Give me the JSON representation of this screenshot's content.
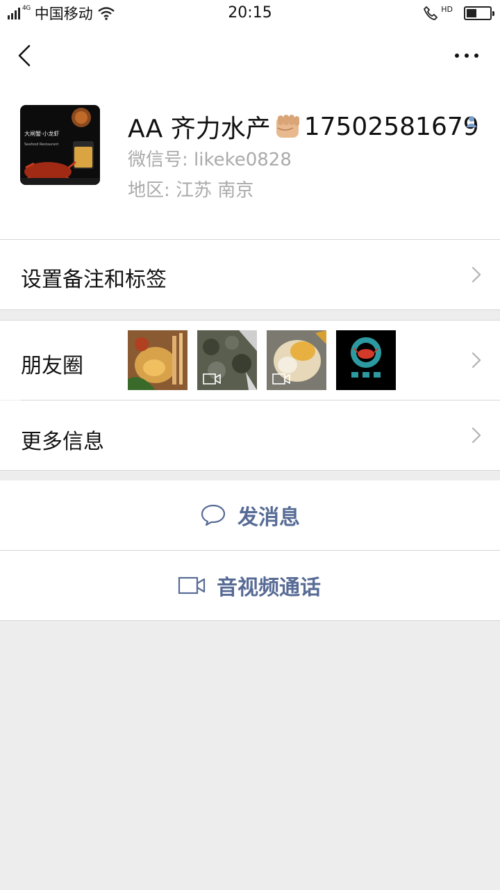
{
  "status_bar": {
    "network": "4G",
    "carrier": "中国移动",
    "time": "20:15",
    "hd": "HD",
    "battery_level": 0.45
  },
  "profile": {
    "name_prefix": "AA 齐力水产",
    "name_suffix": "17502581679",
    "wechat_id": "微信号: likeke0828",
    "region": "地区:  江苏  南京"
  },
  "cells": {
    "remark": "设置备注和标签",
    "moments": "朋友圈",
    "more_info": "更多信息"
  },
  "actions": {
    "message": "发消息",
    "call": "音视频通话"
  },
  "colors": {
    "link": "#576b95",
    "background": "#ededed",
    "secondary_text": "#aaaaaa"
  }
}
